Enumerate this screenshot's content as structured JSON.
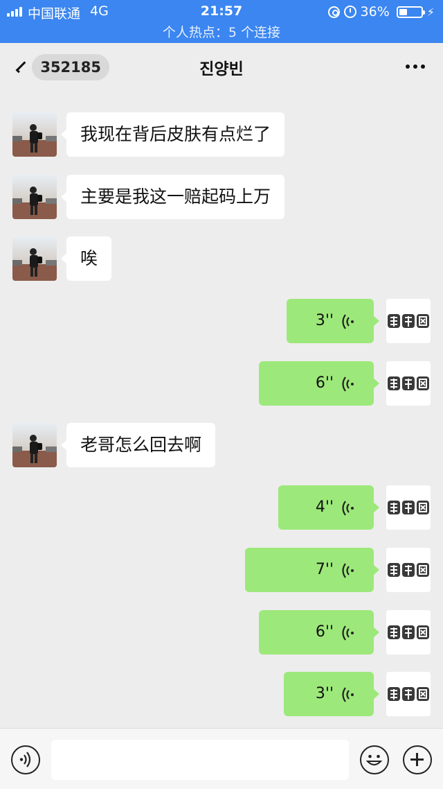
{
  "status_bar": {
    "carrier": "中国联通",
    "network": "4G",
    "time": "21:57",
    "battery": "36%",
    "battery_level": 0.36,
    "hotspot": "个人热点：5 个连接"
  },
  "nav": {
    "back_badge": "352185",
    "title": "진양빈"
  },
  "colors": {
    "status_bar": "#3b86f0",
    "bubble_out": "#9de87a",
    "bubble_in": "#ffffff",
    "background": "#ededed"
  },
  "messages": [
    {
      "side": "left",
      "type": "text",
      "text": "我现在背后皮肤有点烂了"
    },
    {
      "side": "left",
      "type": "text",
      "text": "主要是我这一赔起码上万"
    },
    {
      "side": "left",
      "type": "text",
      "text": "唉"
    },
    {
      "side": "right",
      "type": "voice",
      "duration": "3''"
    },
    {
      "side": "right",
      "type": "voice",
      "duration": "6''"
    },
    {
      "side": "left",
      "type": "text",
      "text": "老哥怎么回去啊"
    },
    {
      "side": "right",
      "type": "voice",
      "duration": "4''"
    },
    {
      "side": "right",
      "type": "voice",
      "duration": "7''"
    },
    {
      "side": "right",
      "type": "voice",
      "duration": "6''"
    },
    {
      "side": "right",
      "type": "voice",
      "duration": "3''"
    }
  ],
  "icons": {
    "back": "chevron-left-icon",
    "more": "more-dots-icon",
    "voice": "voice-input-icon",
    "emoji": "emoji-icon",
    "plus": "plus-icon",
    "voice_wave": "voice-wave-icon"
  }
}
